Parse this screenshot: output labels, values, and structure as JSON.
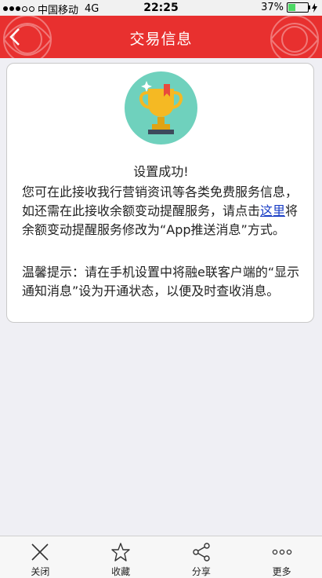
{
  "status_bar": {
    "carrier": "中国移动",
    "network": "4G",
    "time": "22:25",
    "battery": "37%"
  },
  "header": {
    "title": "交易信息"
  },
  "content": {
    "success_text": "设置成功!",
    "p1_before": "您可在此接收我行营销资讯等各类免费服务信息，如还需在此接收余额变动提醒服务，请点击",
    "p1_link": "这里",
    "p1_after": "将余额变动提醒服务修改为“App推送消息”方式。",
    "p2": "温馨提示：请在手机设置中将融e联客户端的“显示通知消息”设为开通状态，以便及时查收消息。"
  },
  "toolbar": {
    "close": "关闭",
    "favorite": "收藏",
    "share": "分享",
    "more": "更多"
  },
  "colors": {
    "header_red": "#e8302f",
    "trophy_circle": "#6fd1bd",
    "link_blue": "#1a3ec5"
  }
}
